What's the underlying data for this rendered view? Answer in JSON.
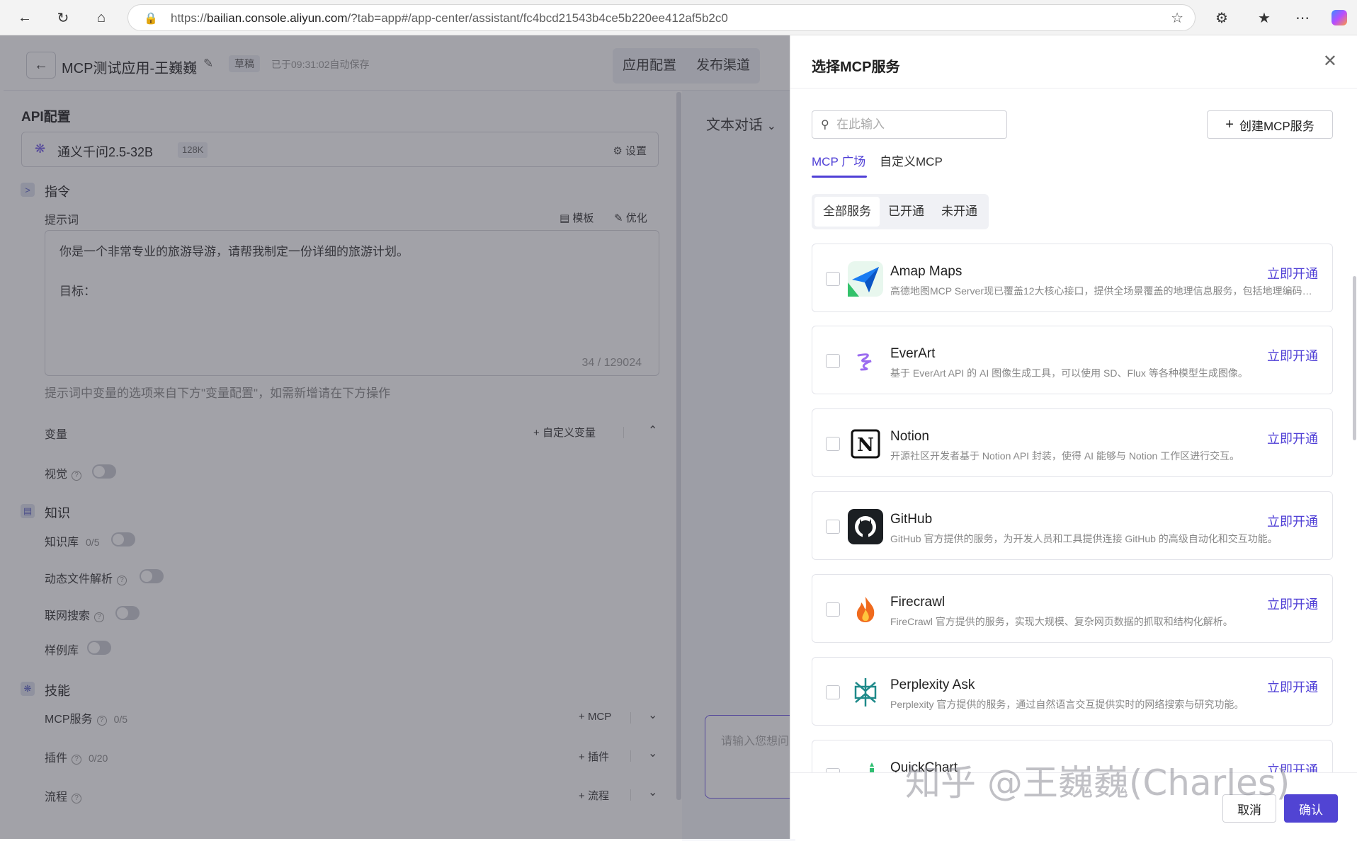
{
  "browser": {
    "url_prefix": "https://",
    "url_host": "bailian.console.aliyun.com",
    "url_rest": "/?tab=app#/app-center/assistant/fc4bcd21543b4ce5b220ee412af5b2c0"
  },
  "header": {
    "app_title": "MCP测试应用-王巍巍",
    "draft_badge": "草稿",
    "autosave": "已于09:31:02自动保存",
    "tabs": [
      "应用配置",
      "发布渠道"
    ]
  },
  "api_config": {
    "title": "API配置",
    "model_name": "通义千问2.5-32B",
    "model_tag": "128K",
    "settings_label": "设置"
  },
  "instructions": {
    "title": "指令",
    "prompt_label": "提示词",
    "template_label": "模板",
    "optimize_label": "优化",
    "prompt_text": "你是一个非常专业的旅游导游，请帮我制定一份详细的旅游计划。\n\n目标：",
    "counter": "34 / 129024",
    "hint": "提示词中变量的选项来自下方\"变量配置\"，如需新增请在下方操作",
    "variables_label": "变量",
    "custom_variable": "自定义变量",
    "vision_label": "视觉"
  },
  "knowledge": {
    "title": "知识",
    "kb_label": "知识库",
    "kb_count": "0/5",
    "file_parse_label": "动态文件解析",
    "web_search_label": "联网搜索",
    "examples_label": "样例库"
  },
  "skills": {
    "title": "技能",
    "mcp_label": "MCP服务",
    "mcp_count": "0/5",
    "mcp_add": "MCP",
    "plugin_label": "插件",
    "plugin_count": "0/20",
    "plugin_add": "插件",
    "flow_label": "流程",
    "flow_add": "流程"
  },
  "chat": {
    "mode": "文本对话",
    "input_placeholder": "请输入您想问"
  },
  "drawer": {
    "title": "选择MCP服务",
    "search_placeholder": "在此输入",
    "create_button": "创建MCP服务",
    "main_tabs": [
      "MCP 广场",
      "自定义MCP"
    ],
    "filters": [
      "全部服务",
      "已开通",
      "未开通"
    ],
    "services": [
      {
        "name": "Amap Maps",
        "desc": "高德地图MCP Server现已覆盖12大核心接口，提供全场景覆盖的地理信息服务，包括地理编码、逆地理编码、IP定位、天气查询、骑行路径规划…",
        "action": "立即开通",
        "icon": "paper-plane-icon"
      },
      {
        "name": "EverArt",
        "desc": "基于 EverArt API 的 AI 图像生成工具，可以使用 SD、Flux 等各种模型生成图像。",
        "action": "立即开通",
        "icon": "everart-icon"
      },
      {
        "name": "Notion",
        "desc": "开源社区开发者基于 Notion API 封装，使得 AI 能够与 Notion 工作区进行交互。",
        "action": "立即开通",
        "icon": "notion-icon"
      },
      {
        "name": "GitHub",
        "desc": "GitHub 官方提供的服务，为开发人员和工具提供连接 GitHub 的高级自动化和交互功能。",
        "action": "立即开通",
        "icon": "github-icon"
      },
      {
        "name": "Firecrawl",
        "desc": "FireCrawl 官方提供的服务，实现大规模、复杂网页数据的抓取和结构化解析。",
        "action": "立即开通",
        "icon": "fire-icon"
      },
      {
        "name": "Perplexity Ask",
        "desc": "Perplexity 官方提供的服务，通过自然语言交互提供实时的网络搜索与研究功能。",
        "action": "立即开通",
        "icon": "perplexity-icon"
      },
      {
        "name": "QuickChart",
        "desc": "",
        "action": "立即开通",
        "icon": "chart-icon"
      }
    ],
    "cancel": "取消",
    "confirm": "确认"
  },
  "watermark": "知乎 @王巍巍(Charles)"
}
